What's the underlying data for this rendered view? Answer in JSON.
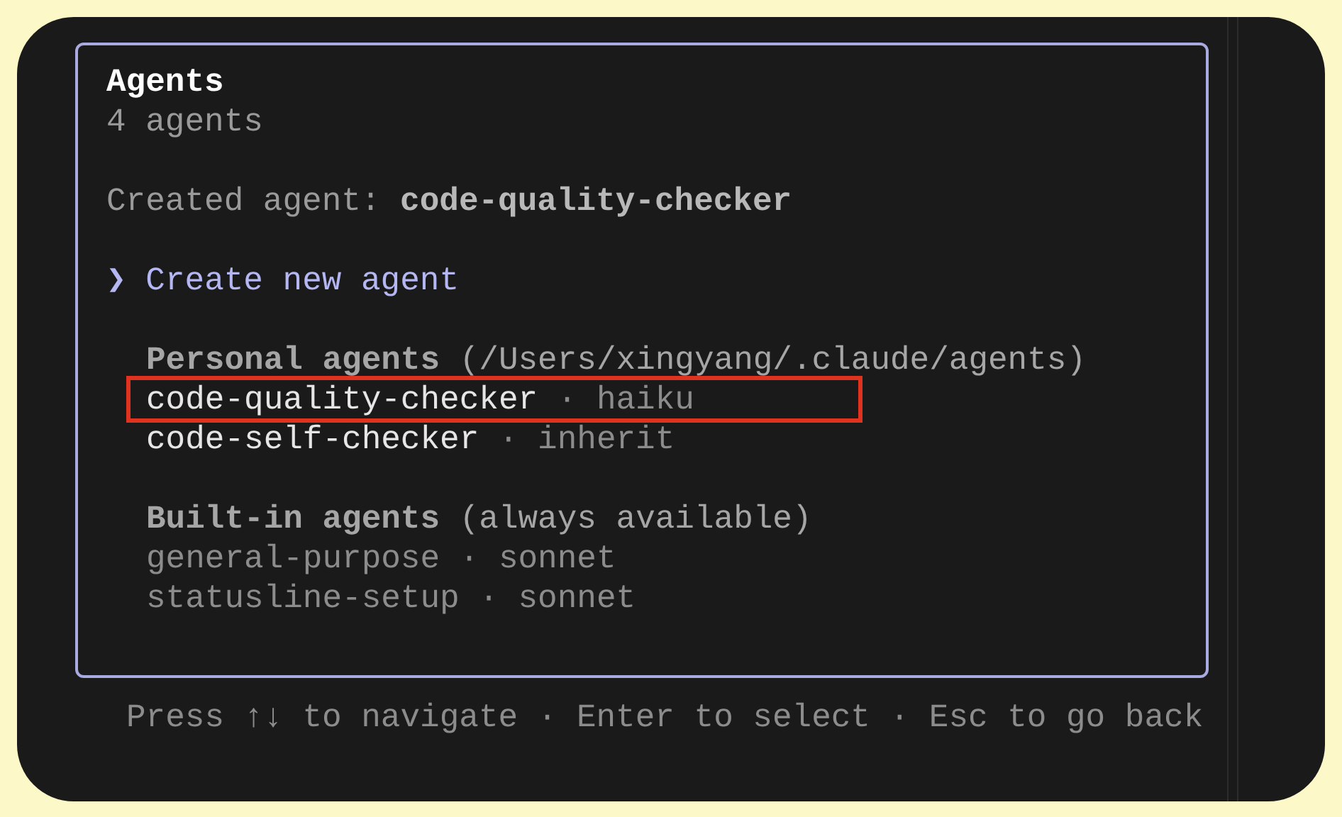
{
  "dialog": {
    "title": "Agents",
    "subtitle": "4 agents",
    "notice": "Created agent: **code-quality-checker**",
    "menu": [
      {
        "pointer": "❯",
        "label": "Create new agent",
        "selected": true
      }
    ],
    "groups": [
      {
        "heading": "**Personal agents** (/Users/xingyang/.claude/agents)",
        "builtin": false,
        "items": [
          {
            "name": "code-quality-checker",
            "separator": "·",
            "model": "haiku",
            "highlighted": true
          },
          {
            "name": "code-self-checker",
            "separator": "·",
            "model": "inherit",
            "highlighted": false
          }
        ]
      },
      {
        "heading": "**Built-in agents** (always available)",
        "builtin": true,
        "items": [
          {
            "name": "general-purpose",
            "separator": "·",
            "model": "sonnet",
            "highlighted": false
          },
          {
            "name": "statusline-setup",
            "separator": "·",
            "model": "sonnet",
            "highlighted": false
          }
        ]
      }
    ]
  },
  "hint": "Press ↑↓ to navigate · Enter to select · Esc to go back"
}
